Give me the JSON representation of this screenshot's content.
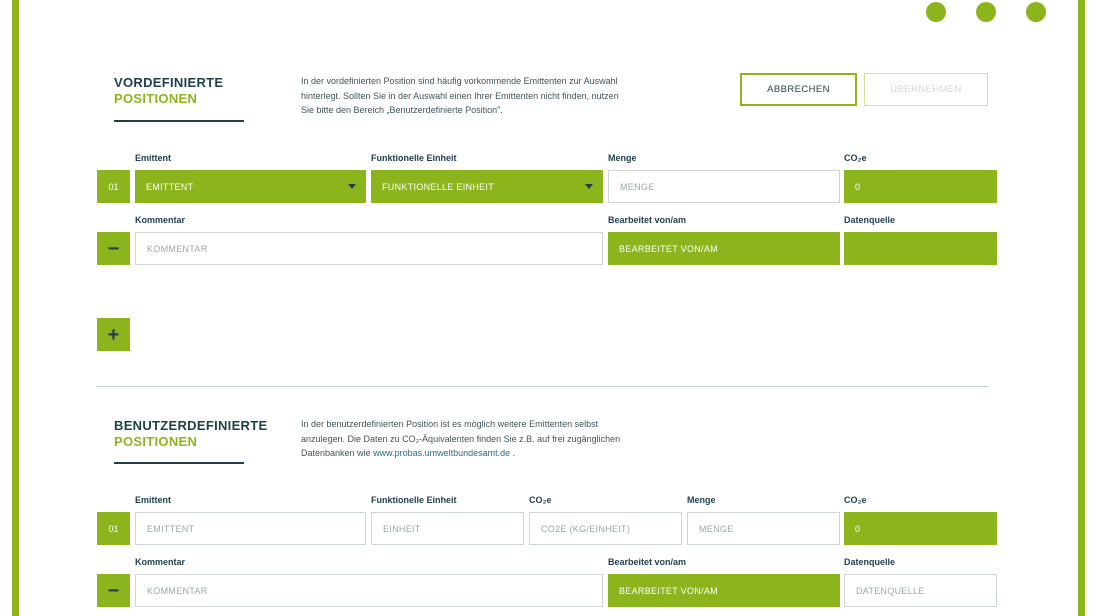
{
  "colors": {
    "accent": "#8cb51d",
    "dark": "#1f3f4f",
    "border": "#cfd6da"
  },
  "predefined": {
    "title": "VORDEFINIERTE",
    "subtitle": "POSITIONEN",
    "description_lines": [
      "In der vordefinierten Position sind häufig vorkommende Emittenten zur Auswahl",
      "hinterlegt. Sollten Sie in der Auswahl einen Ihrer Emittenten nicht finden, nutzen",
      "Sie bitte den Bereich „Benutzerdefinierte Position\"."
    ],
    "cancel_label": "ABBRECHEN",
    "apply_label": "ÜBERNEHMEN",
    "labels": {
      "emittent": "Emittent",
      "unit": "Funktionelle Einheit",
      "amount": "Menge",
      "co2e": "CO₂e",
      "comment": "Kommentar",
      "edited": "Bearbeitet von/am",
      "source": "Datenquelle"
    },
    "row": {
      "index": "01",
      "emittent": "EMITTENT",
      "unit": "FUNKTIONELLE EINHEIT",
      "amount_placeholder": "MENGE",
      "co2e": "0",
      "comment_placeholder": "KOMMENTAR",
      "edited": "BEARBEITET VON/AM",
      "source": ""
    },
    "remove_label": "−",
    "add_label": "+"
  },
  "custom": {
    "title": "BENUTZERDEFINIERTE",
    "subtitle": "POSITIONEN",
    "description_lines": [
      "In der benutzerdefinierten Position ist es möglich weitere Emittenten selbst",
      "anzulegen. Die Daten zu CO₂-Äquivalenten finden Sie z.B. auf frei zugänglichen"
    ],
    "description_prefix": "Datenbanken wie ",
    "description_link": "www.probas.umweltbundesamt.de",
    "description_suffix": " .",
    "labels": {
      "emittent": "Emittent",
      "unit": "Funktionelle Einheit",
      "co2_factor": "CO₂e",
      "amount": "Menge",
      "co2e": "CO₂e",
      "comment": "Kommentar",
      "edited": "Bearbeitet von/am",
      "source": "Datenquelle"
    },
    "row": {
      "index": "01",
      "emittent_placeholder": "EMITTENT",
      "unit_placeholder": "EINHEIT",
      "co2_factor_placeholder": "CO2E (KG/EINHEIT)",
      "amount_placeholder": "MENGE",
      "co2e": "0",
      "comment_placeholder": "KOMMENTAR",
      "edited": "BEARBEITET VON/AM",
      "source_placeholder": "DATENQUELLE"
    },
    "remove_label": "−"
  }
}
